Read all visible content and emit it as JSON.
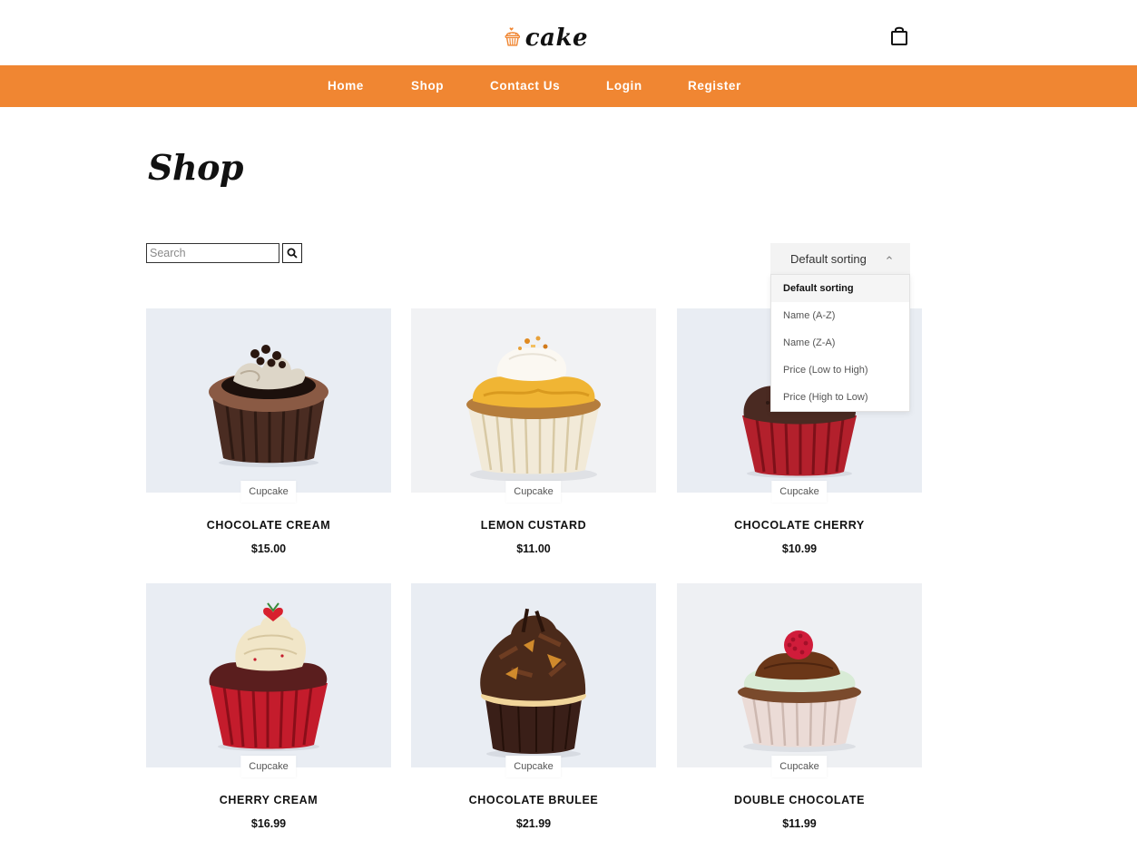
{
  "brand": {
    "name": "cake",
    "logo_icon": "cupcake-heart-logo",
    "accent": "#f08632"
  },
  "header": {
    "cart_icon": "shopping-bag-icon"
  },
  "nav": {
    "items": [
      {
        "label": "Home"
      },
      {
        "label": "Shop"
      },
      {
        "label": "Contact Us"
      },
      {
        "label": "Login"
      },
      {
        "label": "Register"
      }
    ]
  },
  "page": {
    "title": "Shop"
  },
  "search": {
    "placeholder": "Search",
    "value": "",
    "button_icon": "search-icon"
  },
  "sort": {
    "selected": "Default sorting",
    "expanded": true,
    "options": [
      {
        "label": "Default sorting"
      },
      {
        "label": "Name (A-Z)"
      },
      {
        "label": "Name (Z-A)"
      },
      {
        "label": "Price (Low to High)"
      },
      {
        "label": "Price (High to Low)"
      }
    ]
  },
  "products": [
    {
      "name": "CHOCOLATE CREAM",
      "price": "$15.00",
      "category": "Cupcake"
    },
    {
      "name": "LEMON CUSTARD",
      "price": "$11.00",
      "category": "Cupcake"
    },
    {
      "name": "CHOCOLATE CHERRY",
      "price": "$10.99",
      "category": "Cupcake"
    },
    {
      "name": "CHERRY CREAM",
      "price": "$16.99",
      "category": "Cupcake"
    },
    {
      "name": "CHOCOLATE BRULEE",
      "price": "$21.99",
      "category": "Cupcake"
    },
    {
      "name": "DOUBLE CHOCOLATE",
      "price": "$11.99",
      "category": "Cupcake"
    }
  ]
}
